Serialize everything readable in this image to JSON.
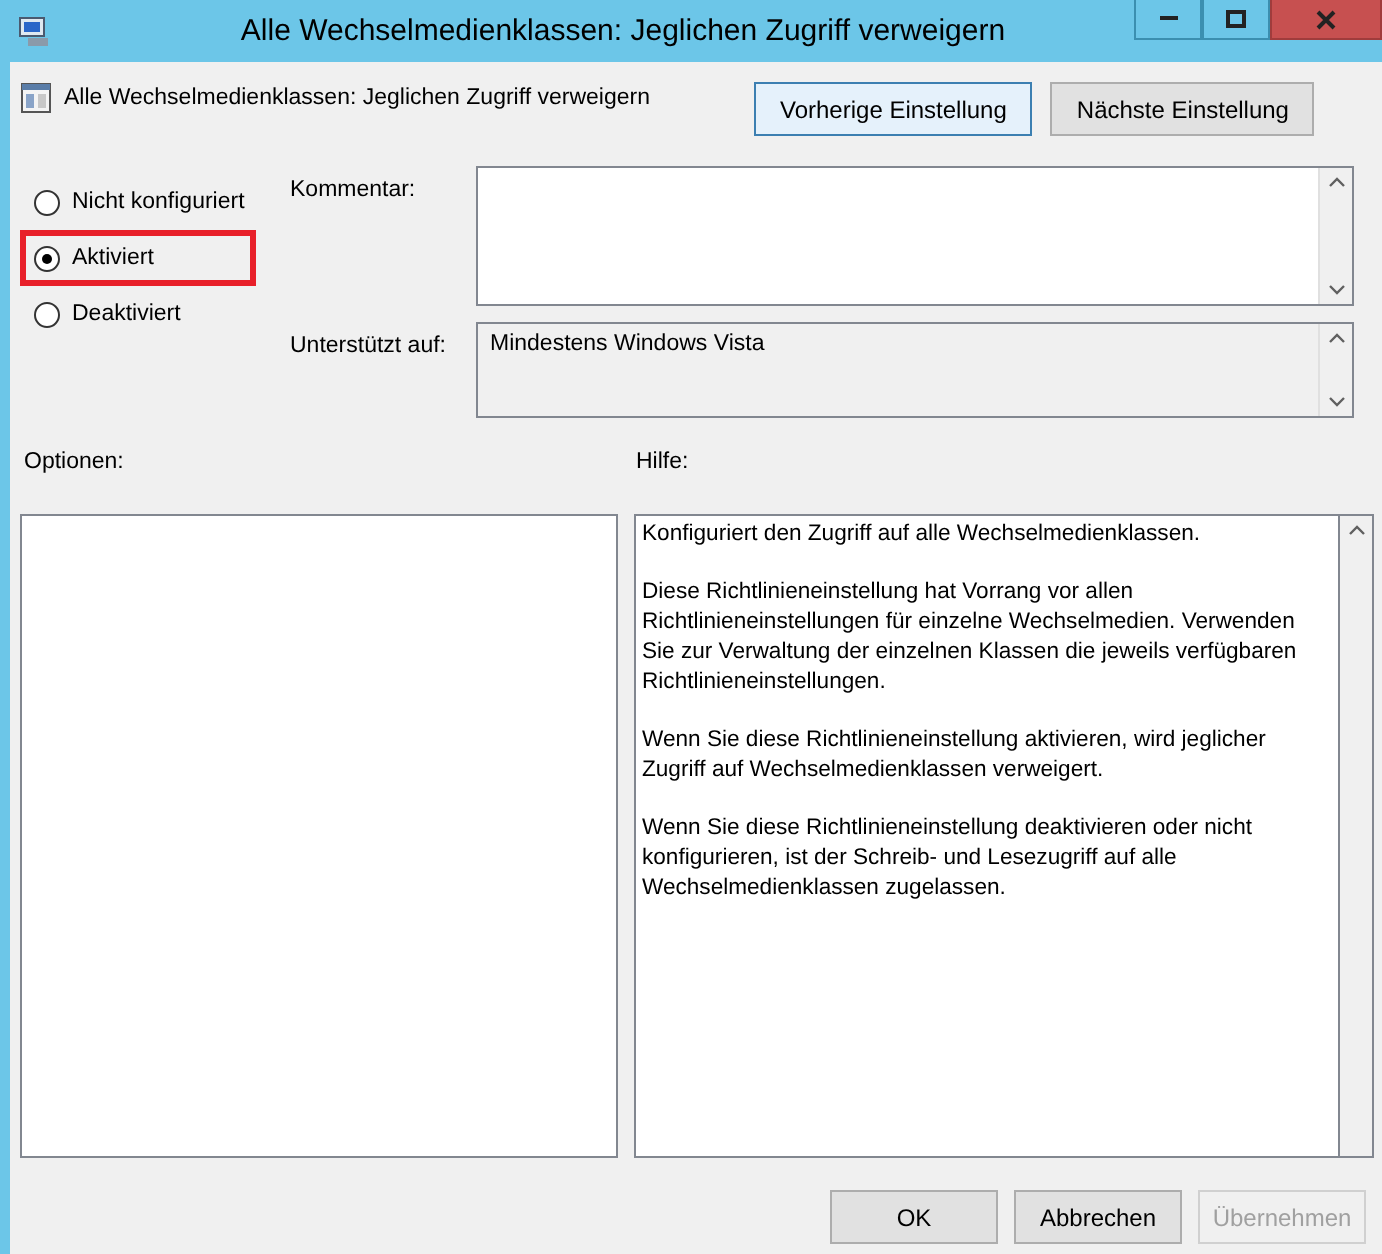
{
  "window": {
    "title": "Alle Wechselmedienklassen: Jeglichen Zugriff verweigern"
  },
  "header": {
    "policy_name": "Alle Wechselmedienklassen: Jeglichen Zugriff verweigern",
    "buttons": [
      {
        "label": "Vorherige Einstellung",
        "focused": true
      },
      {
        "label": "Nächste Einstellung",
        "focused": false
      }
    ]
  },
  "state_options": [
    {
      "label": "Nicht konfiguriert",
      "selected": false,
      "highlighted": false
    },
    {
      "label": "Aktiviert",
      "selected": true,
      "highlighted": true
    },
    {
      "label": "Deaktiviert",
      "selected": false,
      "highlighted": false
    }
  ],
  "comment": {
    "label": "Kommentar:"
  },
  "supported_on": {
    "label": "Unterstützt auf:",
    "value": "Mindestens Windows Vista"
  },
  "options": {
    "label": "Optionen:"
  },
  "help": {
    "label": "Hilfe:",
    "paragraphs": [
      "Konfiguriert den Zugriff auf alle Wechselmedienklassen.",
      "Diese Richtlinieneinstellung hat Vorrang vor allen Richtlinieneinstellungen für einzelne Wechselmedien. Verwenden Sie zur Verwaltung der einzelnen Klassen die jeweils verfügbaren Richtlinieneinstellungen.",
      "Wenn Sie diese Richtlinieneinstellung aktivieren, wird jeglicher Zugriff auf Wechselmedienklassen verweigert.",
      "Wenn Sie diese Richtlinieneinstellung deaktivieren oder nicht konfigurieren, ist der Schreib- und Lesezugriff auf alle Wechselmedienklassen zugelassen."
    ]
  },
  "footer": {
    "buttons": [
      {
        "label": "OK",
        "disabled": false
      },
      {
        "label": "Abbrechen",
        "disabled": false
      },
      {
        "label": "Übernehmen",
        "disabled": true
      }
    ]
  }
}
